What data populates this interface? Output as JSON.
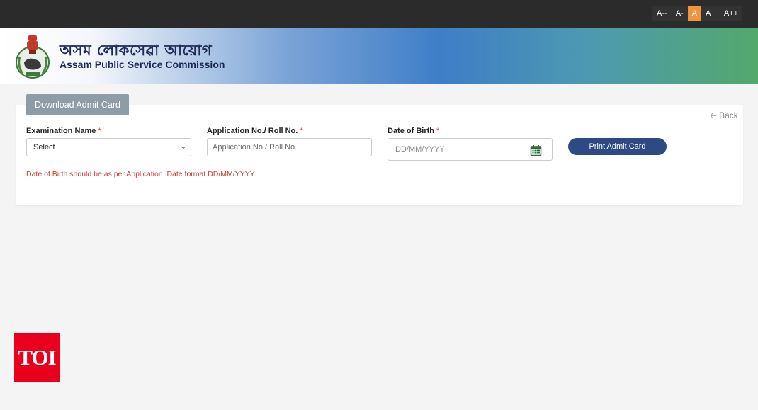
{
  "font_sizer": [
    "A--",
    "A-",
    "A",
    "A+",
    "A++"
  ],
  "header": {
    "title_assamese": "অসম লোকসেৱা আয়োগ",
    "title_english": "Assam Public Service Commission"
  },
  "tab": {
    "label": "Download Admit Card"
  },
  "back_label": "Back",
  "form": {
    "exam_label": "Examination Name",
    "exam_value": "Select",
    "app_label": "Application No./ Roll No.",
    "app_placeholder": "Application No./ Roll No.",
    "dob_label": "Date of Birth",
    "dob_placeholder": "DD/MM/YYYY",
    "required_marker": "*",
    "print_button": "Print Admit Card",
    "note": "Date of Birth should be as per Application. Date format DD/MM/YYYY."
  },
  "watermark": "TOI",
  "colors": {
    "topbar": "#2b2b2b",
    "active_size": "#f0953c",
    "primary_button": "#2e4a84",
    "tab_button": "#8e9ca7",
    "error_text": "#d0392b",
    "toi_red": "#e8001c"
  }
}
